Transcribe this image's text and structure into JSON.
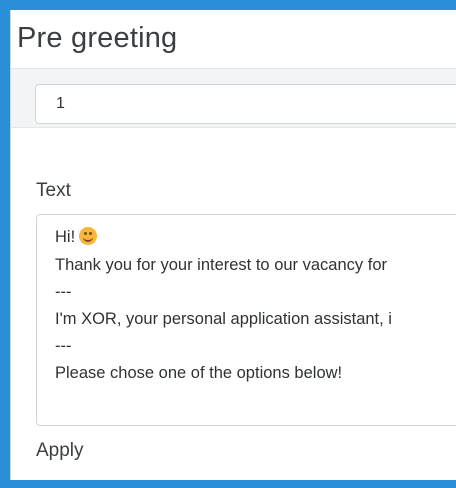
{
  "header": {
    "title": "Pre greeting"
  },
  "selector": {
    "value": "1"
  },
  "text_field": {
    "label": "Text",
    "lines": [
      "Hi!",
      "Thank you for your interest to our vacancy for",
      "---",
      "I'm XOR, your personal application assistant, i",
      "---",
      "Please chose one of the options below!"
    ],
    "emoji": "smiling-face-emoji"
  },
  "apply": {
    "label": "Apply"
  },
  "colors": {
    "frame": "#2a8fd6",
    "band": "#f3f4f5",
    "border": "#cfd4d8"
  }
}
